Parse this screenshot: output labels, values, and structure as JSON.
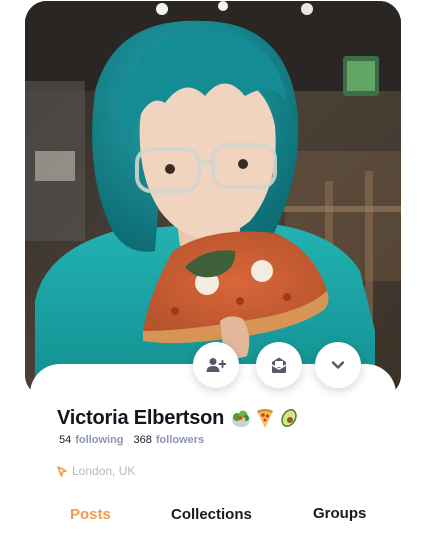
{
  "profile": {
    "name": "Victoria Elbertson",
    "name_emojis": [
      "salad-emoji",
      "pizza-emoji",
      "avocado-emoji"
    ],
    "following_count": "54",
    "following_label": "following",
    "followers_count": "368",
    "followers_label": "followers",
    "location": "London, UK"
  },
  "actions": [
    {
      "icon": "add-user-icon"
    },
    {
      "icon": "message-inbox-icon"
    },
    {
      "icon": "chevron-down-icon"
    }
  ],
  "tabs": [
    {
      "label": "Posts",
      "active": true
    },
    {
      "label": "Collections",
      "active": false
    },
    {
      "label": "Groups",
      "active": false
    }
  ],
  "colors": {
    "accent": "#f49b4b",
    "text_dark": "#15151f",
    "stat_label": "#8d93b8",
    "muted": "#b7b7c3",
    "hair_teal": "#1b8e96",
    "sweater_teal": "#1fa7a8"
  }
}
